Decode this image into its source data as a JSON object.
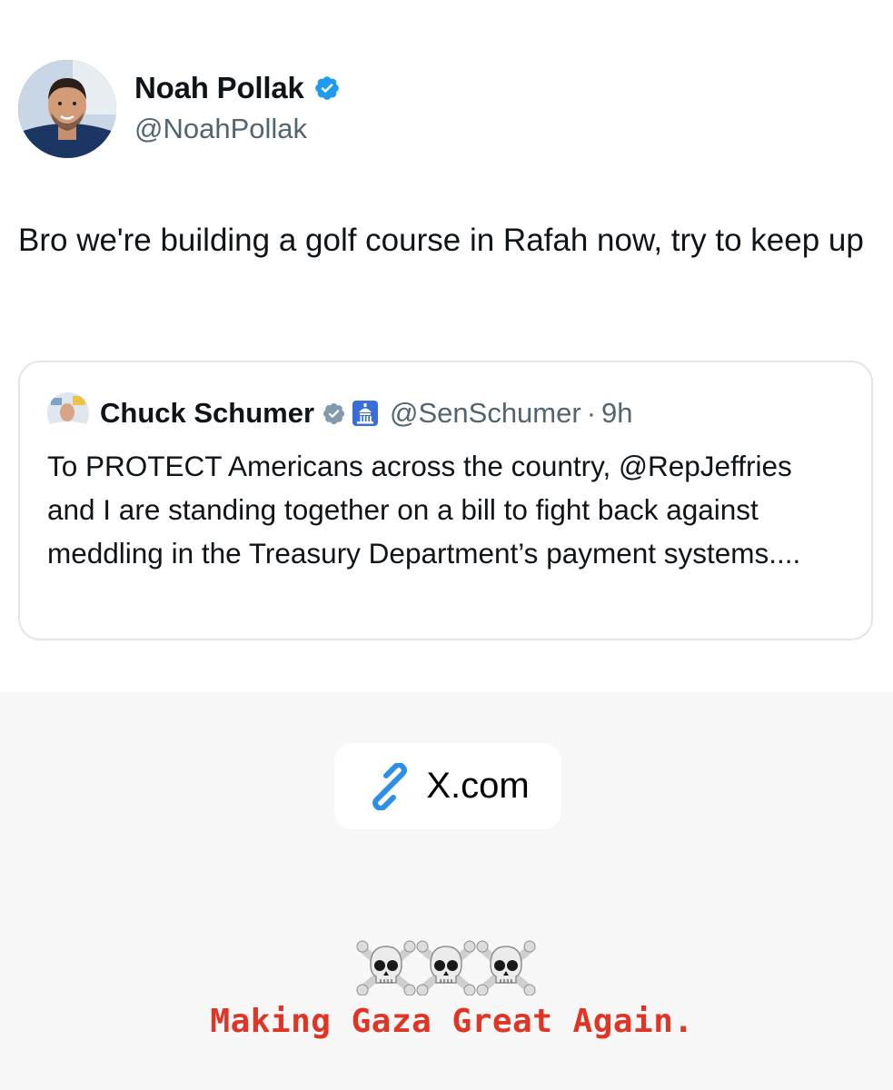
{
  "tweet": {
    "author_name": "Noah Pollak",
    "author_handle": "@NoahPollak",
    "text": "Bro we're building a golf course in Rafah now, try to keep up",
    "verified_icon": "verified-badge-icon",
    "avatar_icon": "profile-photo"
  },
  "quoted_tweet": {
    "author_name": "Chuck Schumer",
    "author_handle": "@SenSchumer",
    "separator": "·",
    "time": "9h",
    "text": "To PROTECT Americans across the country, @RepJeffries and I are standing together on a bill to fight back against meddling in the Treasury Department’s payment systems....",
    "badges": [
      "verified-badge-icon",
      "government-capitol-icon"
    ]
  },
  "link_sticker": {
    "label": "X.com",
    "icon": "link-icon"
  },
  "caption": {
    "emoji": "☠️☠️☠️",
    "text": "Making Gaza Great Again."
  },
  "colors": {
    "verified_blue": "#1d9bf0",
    "handle_gray": "#536471",
    "caption_red": "#e03425",
    "link_blue": "#2f8fe6"
  }
}
